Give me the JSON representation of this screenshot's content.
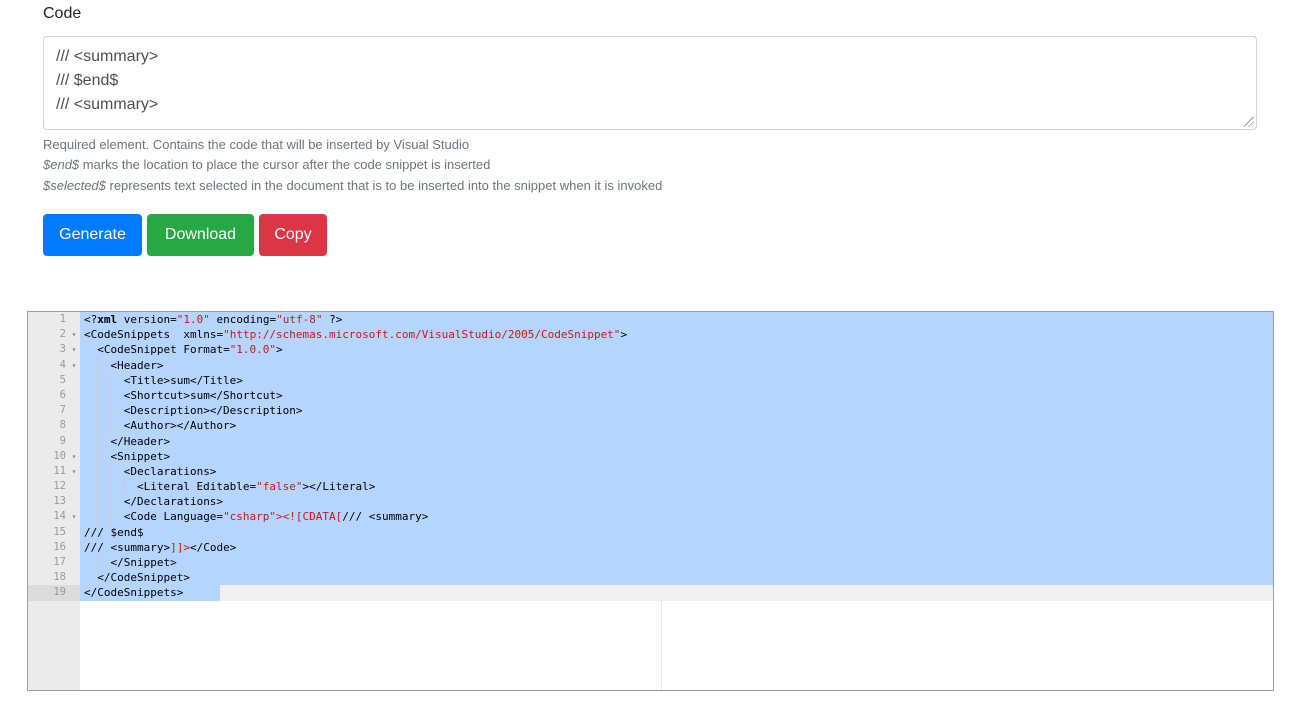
{
  "form": {
    "code_label": "Code",
    "code_lines": [
      "/// <summary>",
      "/// $end$",
      "/// <summary>"
    ],
    "help_1": "Required element. Contains the code that will be inserted by Visual Studio",
    "help_2_em": "$end$",
    "help_2_rest": " marks the location to place the cursor after the code snippet is inserted",
    "help_3_em": "$selected$",
    "help_3_rest": " represents text selected in the document that is to be inserted into the snippet when it is invoked"
  },
  "buttons": {
    "generate": "Generate",
    "download": "Download",
    "copy": "Copy"
  },
  "colors": {
    "generate": "#007bff",
    "download": "#28a745",
    "copy": "#dc3545",
    "selection": "#b5d5ff"
  },
  "editor": {
    "lines": [
      {
        "n": "1",
        "fold": false,
        "indent": 0,
        "segments": [
          [
            "tag",
            "<?"
          ],
          [
            "bold",
            "xml"
          ],
          [
            "attr",
            " version="
          ],
          [
            "str",
            "\"1.0\""
          ],
          [
            "attr",
            " encoding="
          ],
          [
            "str",
            "\"utf-8\""
          ],
          [
            "tag",
            " ?>"
          ]
        ]
      },
      {
        "n": "2",
        "fold": true,
        "indent": 0,
        "segments": [
          [
            "tag",
            "<CodeSnippets  xmlns="
          ],
          [
            "str",
            "\"http://schemas.microsoft.com/VisualStudio/2005/CodeSnippet\""
          ],
          [
            "tag",
            ">"
          ]
        ]
      },
      {
        "n": "3",
        "fold": true,
        "indent": 1,
        "segments": [
          [
            "tag",
            "<CodeSnippet Format="
          ],
          [
            "str",
            "\"1.0.0\""
          ],
          [
            "tag",
            ">"
          ]
        ]
      },
      {
        "n": "4",
        "fold": true,
        "indent": 2,
        "segments": [
          [
            "tag",
            "<Header>"
          ]
        ]
      },
      {
        "n": "5",
        "fold": false,
        "indent": 3,
        "segments": [
          [
            "tag",
            "<Title>sum</Title>"
          ]
        ]
      },
      {
        "n": "6",
        "fold": false,
        "indent": 3,
        "segments": [
          [
            "tag",
            "<Shortcut>sum</Shortcut>"
          ]
        ]
      },
      {
        "n": "7",
        "fold": false,
        "indent": 3,
        "segments": [
          [
            "tag",
            "<Description></Description>"
          ]
        ]
      },
      {
        "n": "8",
        "fold": false,
        "indent": 3,
        "segments": [
          [
            "tag",
            "<Author></Author>"
          ]
        ]
      },
      {
        "n": "9",
        "fold": false,
        "indent": 2,
        "segments": [
          [
            "tag",
            "</Header>"
          ]
        ]
      },
      {
        "n": "10",
        "fold": true,
        "indent": 2,
        "segments": [
          [
            "tag",
            "<Snippet>"
          ]
        ]
      },
      {
        "n": "11",
        "fold": true,
        "indent": 3,
        "segments": [
          [
            "tag",
            "<Declarations>"
          ]
        ]
      },
      {
        "n": "12",
        "fold": false,
        "indent": 4,
        "segments": [
          [
            "tag",
            "<Literal Editable="
          ],
          [
            "str",
            "\"false\""
          ],
          [
            "tag",
            "></Literal>"
          ]
        ]
      },
      {
        "n": "13",
        "fold": false,
        "indent": 3,
        "segments": [
          [
            "tag",
            "</Declarations>"
          ]
        ]
      },
      {
        "n": "14",
        "fold": true,
        "indent": 3,
        "segments": [
          [
            "tag",
            "<Code Language="
          ],
          [
            "str",
            "\"csharp\""
          ],
          [
            "cdata",
            "><![CDATA["
          ],
          [
            "tag",
            "/// <summary>"
          ]
        ]
      },
      {
        "n": "15",
        "fold": false,
        "indent": 0,
        "segments": [
          [
            "tag",
            "/// $end$"
          ]
        ]
      },
      {
        "n": "16",
        "fold": false,
        "indent": 0,
        "segments": [
          [
            "tag",
            "/// <summary>"
          ],
          [
            "cdata",
            "]]>"
          ],
          [
            "tag",
            "</Code>"
          ]
        ]
      },
      {
        "n": "17",
        "fold": false,
        "indent": 2,
        "segments": [
          [
            "tag",
            "</Snippet>"
          ]
        ]
      },
      {
        "n": "18",
        "fold": false,
        "indent": 1,
        "segments": [
          [
            "tag",
            "</CodeSnippet>"
          ]
        ]
      },
      {
        "n": "19",
        "fold": false,
        "indent": 0,
        "segments": [
          [
            "tag",
            "</CodeSnippets>"
          ]
        ]
      }
    ]
  }
}
